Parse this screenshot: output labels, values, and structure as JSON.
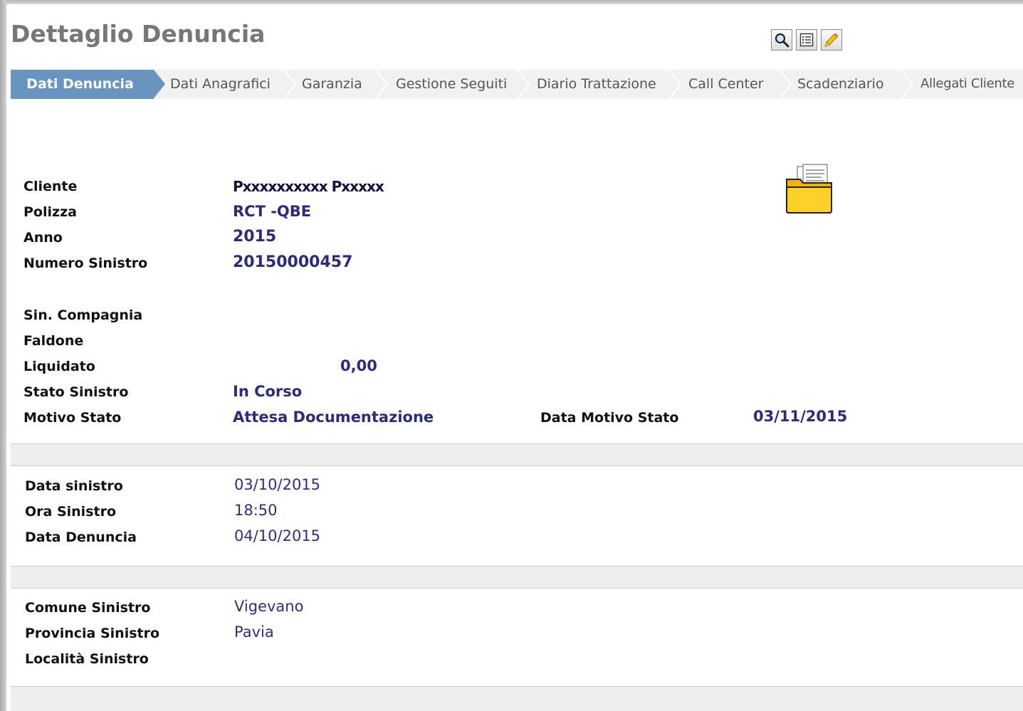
{
  "page": {
    "title": "Dettaglio Denuncia"
  },
  "toolbar": {
    "icons": [
      "search-icon",
      "list-icon",
      "edit-pencil-icon"
    ]
  },
  "tabs": [
    {
      "label": "Dati Denuncia",
      "active": true
    },
    {
      "label": "Dati Anagrafici"
    },
    {
      "label": "Garanzia"
    },
    {
      "label": "Gestione Seguiti"
    },
    {
      "label": "Diario Trattazione"
    },
    {
      "label": "Call Center"
    },
    {
      "label": "Scadenziario"
    },
    {
      "label": "Allegati Cliente"
    }
  ],
  "summary": {
    "cliente_label": "Cliente",
    "cliente_value": "Pxxxxxxxxxx Pxxxxx",
    "polizza_label": "Polizza",
    "polizza_value": "RCT -QBE",
    "anno_label": "Anno",
    "anno_value": "2015",
    "numero_label": "Numero Sinistro",
    "numero_value": "20150000457",
    "sin_compagnia_label": "Sin. Compagnia",
    "faldone_label": "Faldone",
    "liquidato_label": "Liquidato",
    "liquidato_value": "0,00",
    "stato_label": "Stato Sinistro",
    "stato_value": "In Corso",
    "motivo_label": "Motivo Stato",
    "motivo_value": "Attesa Documentazione",
    "data_motivo_label": "Data Motivo Stato",
    "data_motivo_value": "03/11/2015"
  },
  "dates": {
    "data_sinistro_label": "Data sinistro",
    "data_sinistro_value": "03/10/2015",
    "ora_label": "Ora Sinistro",
    "ora_value": "18:50",
    "data_denuncia_label": "Data Denuncia",
    "data_denuncia_value": "04/10/2015"
  },
  "location": {
    "comune_label": "Comune Sinistro",
    "comune_value": "Vigevano",
    "provincia_label": "Provincia Sinistro",
    "provincia_value": "Pavia",
    "localita_label": "Località Sinistro"
  },
  "colors": {
    "active_tab": "#6a94c0",
    "value_text": "#2b2b7a",
    "title_text": "#777777"
  }
}
